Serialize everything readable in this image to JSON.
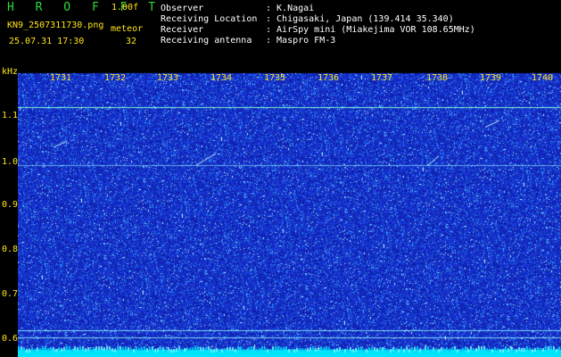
{
  "header": {
    "app_title": "H R O F F T",
    "version": "1.00f",
    "filename": "KN9_2507311730.png",
    "mode_label": "meteor",
    "datetime": "25.07.31 17:30",
    "count": "32",
    "info": [
      {
        "key": "Observer",
        "value": ": K.Nagai"
      },
      {
        "key": "Receiving Location",
        "value": ": Chigasaki, Japan (139.414 35.340)"
      },
      {
        "key": "Receiver",
        "value": ": AirSpy mini (Miakejima VOR 108.65MHz)"
      },
      {
        "key": "Receiving antenna",
        "value": ": Maspro FM-3"
      }
    ]
  },
  "colors": {
    "bg": "#000000",
    "noise": "#1a2bd0",
    "accent": "#ffe51a",
    "title": "#2fd93a",
    "bottom_band": "#00e5ff"
  },
  "spectrogram": {
    "y_unit": "kHz",
    "y_ticks": [
      "1.1",
      "1.0",
      "0.9",
      "0.8",
      "0.7",
      "0.6"
    ],
    "x_ticks": [
      "1731",
      "1732",
      "1733",
      "1734",
      "1735",
      "1736",
      "1737",
      "1738",
      "1739",
      "1740"
    ]
  }
}
